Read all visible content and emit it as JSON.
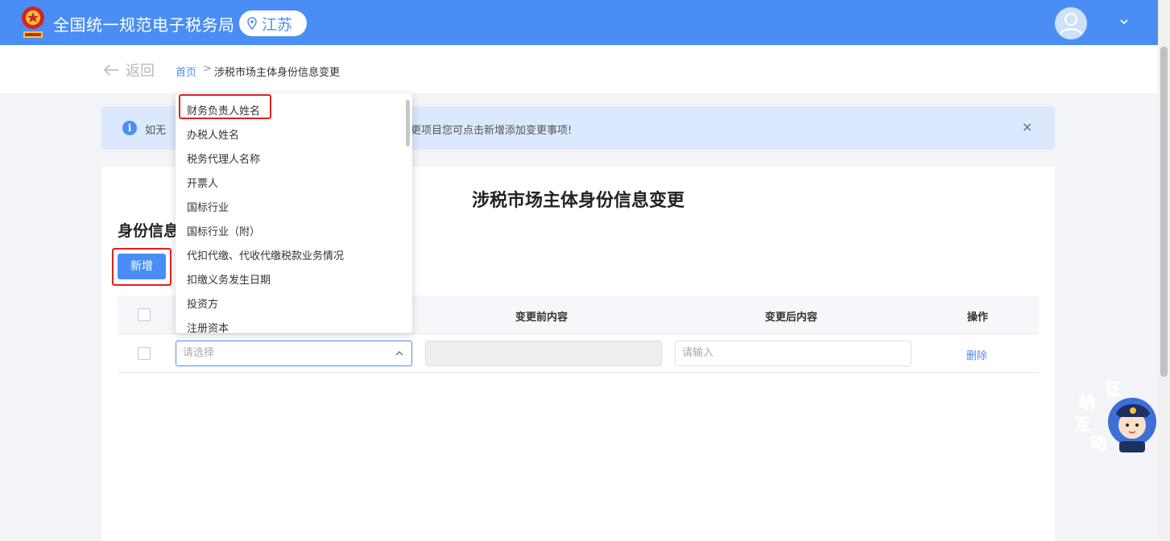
{
  "header": {
    "site_title": "全国统一规范电子税务局",
    "region": "江苏",
    "brand_color": "#4a8ef5",
    "icons": [
      "emblem-icon",
      "location-pin-icon",
      "user-avatar-icon",
      "chevron-down-icon"
    ]
  },
  "breadcrumb": {
    "back_label": "返回",
    "home_label": "首页",
    "separator": ">",
    "current_label": "涉税市场主体身份信息变更"
  },
  "notice": {
    "text_left": "如无",
    "text_right": "更项目您可点击新增添加变更事项!",
    "close_symbol": "×"
  },
  "form": {
    "page_title": "涉税市场主体身份信息变更",
    "section_title": "身份信息",
    "add_button_label": "新增",
    "table": {
      "headers": {
        "before": "变更前内容",
        "after": "变更后内容",
        "action": "操作"
      },
      "row": {
        "select_placeholder": "请选择",
        "after_placeholder": "请输入",
        "delete_label": "删除"
      }
    }
  },
  "dropdown": {
    "options": [
      "财务负责人姓名",
      "办税人姓名",
      "税务代理人名称",
      "开票人",
      "国标行业",
      "国标行业（附）",
      "代扣代缴、代收代缴税款业务情况",
      "扣缴义务发生日期",
      "投资方",
      "注册资本"
    ]
  },
  "mascot": {
    "chars": [
      "征",
      "纳",
      "互",
      "动"
    ]
  }
}
